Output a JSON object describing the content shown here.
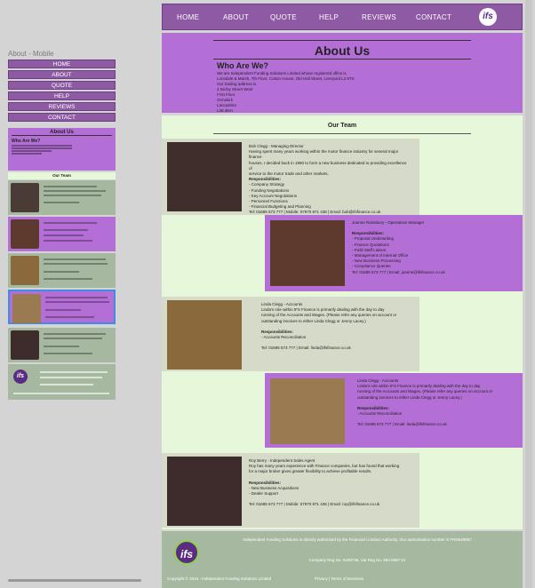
{
  "preview": {
    "title": "About - Mobile"
  },
  "nav": {
    "items": [
      "HOME",
      "ABOUT",
      "QUOTE",
      "HELP",
      "REVIEWS",
      "CONTACT"
    ],
    "logo": "ifs"
  },
  "about": {
    "title": "About Us",
    "who": "Who Are We?",
    "address": [
      "We are Independent Funding Solutions Limited whose registered office is",
      "Lonsdale & Marsh, 7th Floor, Cotton House, Old Hall Street, Liverpool L3 9TX",
      "Our trading address is",
      "4 Derby Street West",
      "First Floor",
      "Ormskirk",
      "Lancashire",
      "L39 3NH"
    ]
  },
  "team": {
    "title": "Our Team",
    "members": [
      {
        "name": "Bob Clegg - Managing Director",
        "bio": [
          "Having spent many years working within the motor finance industry for several major finance",
          "houses, I decided back in 1990 to form a new business dedicated to providing excellence of",
          "service to the motor trade and other markets."
        ],
        "resp_title": "Responsibilities:",
        "resp": [
          "- Company Strategy",
          "- Funding Negotiations",
          "- Key Account Negotiations",
          "- Personnel Functions",
          "- Financial Budgeting and Planning"
        ],
        "contact": "Tel: 01695 573 777 | Mobile: 07970 871 438 | Email: bob@ifsfinance.co.uk"
      },
      {
        "name": "Joanne Rainsbury - Operations Manager",
        "bio": [],
        "resp_title": "Responsibilities:",
        "resp": [
          "- Proposal Underwriting",
          "- Finance Quotations",
          "- Field Staff Liaison",
          "- Management of Internal Office",
          "- New Business Processing",
          "- Compliance Queries"
        ],
        "contact": "Tel: 01695 573 777 | Email: joanne@ifsfinance.co.uk"
      },
      {
        "name": "Linda Clegg - Accounts",
        "bio": [
          "Linda's role within IFS Finance is primarily dealing with the day to day",
          "running of the Accounts and Wages. (Please refer any queries on account or",
          "outstanding invoices to either Linda Clegg or Jenny Lacey.)"
        ],
        "resp_title": "Responsibilities:",
        "resp": [
          "- Accounts Reconciliation"
        ],
        "contact": "Tel: 01695 573 777 | Email: linda@ifsfinance.co.uk"
      },
      {
        "name": "Linda Clegg - Accounts",
        "bio": [
          "Linda's role within IFS Finance is primarily dealing with the day to day",
          "running of the Accounts and Wages. (Please refer any queries on account or",
          "outstanding invoices to either Linda Clegg or Jenny Lacey.)"
        ],
        "resp_title": "Responsibilities:",
        "resp": [
          "- Accounts Reconciliation"
        ],
        "contact": "Tel: 01695 573 777 | Email: linda@ifsfinance.co.uk"
      },
      {
        "name": "Roy Berry - Independent Sales Agent",
        "bio": [
          "Roy has many years experience with Finance companies, but has found that working",
          "for a major broker gives greater flexibility to achieve profitable results."
        ],
        "resp_title": "Responsibilities:",
        "resp": [
          "- New Business Acquisitions",
          "- Dealer Support"
        ],
        "contact": "Tel: 01695 573 777 | Mobile: 07970 871 436 | Email: roy@ifsfinance.co.uk"
      }
    ]
  },
  "footer": {
    "logo": "ifs",
    "line1": "Independent Funding Solutions is directly authorised by the Financial Conduct Authority. Our authorisation number is FRN629957",
    "line2": "Company Reg No. 5180735, Vat Reg No. 864 6997 51",
    "copyright": "Copyright © 2016 - Independent Funding Solutions Limited",
    "links": "Privacy | Terms of Business"
  },
  "colors": {
    "purple": "#8e5aa3",
    "lilac": "#b46fd6",
    "mint": "#e6f7da",
    "sage": "#a7b8a0",
    "card_grey": "#d6dbc9"
  }
}
